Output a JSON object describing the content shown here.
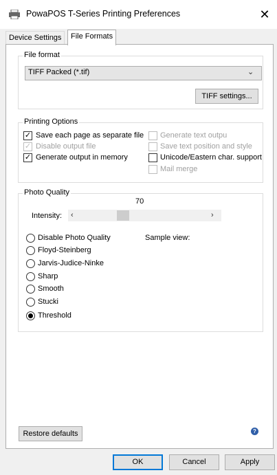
{
  "window": {
    "title": "PowaPOS T-Series Printing Preferences",
    "close": "✕"
  },
  "tabs": [
    {
      "label": "Device Settings"
    },
    {
      "label": "File Formats"
    }
  ],
  "file_format": {
    "group_label": "File format",
    "selected": "TIFF Packed (*.tif)",
    "settings_button": "TIFF settings..."
  },
  "printing_options": {
    "group_label": "Printing Options",
    "left": [
      {
        "label": "Save each page as separate file",
        "checked": true,
        "enabled": true
      },
      {
        "label": "Disable output file",
        "checked": true,
        "enabled": false
      },
      {
        "label": "Generate output in memory",
        "checked": true,
        "enabled": true
      }
    ],
    "right": [
      {
        "label": "Generate text outpu",
        "checked": false,
        "enabled": false
      },
      {
        "label": "Save text position and style",
        "checked": false,
        "enabled": false
      },
      {
        "label": "Unicode/Eastern char. support",
        "checked": false,
        "enabled": true
      },
      {
        "label": "Mail merge",
        "checked": false,
        "enabled": false
      }
    ]
  },
  "photo_quality": {
    "group_label": "Photo Quality",
    "intensity_value": "70",
    "intensity_label": "Intensity:",
    "intensity_fraction": 0.34,
    "sample_view_label": "Sample view:",
    "options": [
      {
        "label": "Disable Photo Quality",
        "selected": false
      },
      {
        "label": "Floyd-Steinberg",
        "selected": false
      },
      {
        "label": "Jarvis-Judice-Ninke",
        "selected": false
      },
      {
        "label": "Sharp",
        "selected": false
      },
      {
        "label": "Smooth",
        "selected": false
      },
      {
        "label": "Stucki",
        "selected": false
      },
      {
        "label": "Threshold",
        "selected": true
      }
    ]
  },
  "restore_defaults": "Restore defaults",
  "help_glyph": "?",
  "footer": {
    "ok": "OK",
    "cancel": "Cancel",
    "apply": "Apply"
  },
  "colors": {
    "accent": "#0078d7",
    "help": "#2f5ea8"
  }
}
